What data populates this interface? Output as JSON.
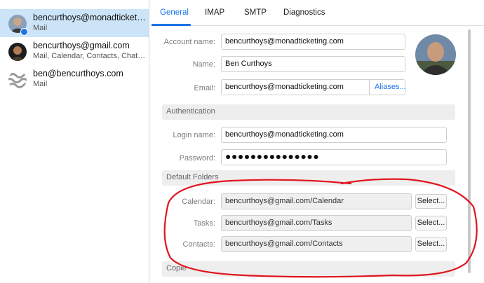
{
  "accounts": [
    {
      "name": "bencurthoys@monadticketing...",
      "sub": "Mail",
      "avatar": "person-photo-avatar",
      "selected": true
    },
    {
      "name": "bencurthoys@gmail.com",
      "sub": "Mail, Calendar, Contacts, Chat, Onli...",
      "avatar": "person-photo-avatar",
      "selected": false
    },
    {
      "name": "ben@bencurthoys.com",
      "sub": "Mail",
      "avatar": "wave-logo-avatar",
      "selected": false
    }
  ],
  "tabs": [
    {
      "label": "General",
      "active": true
    },
    {
      "label": "IMAP",
      "active": false
    },
    {
      "label": "SMTP",
      "active": false
    },
    {
      "label": "Diagnostics",
      "active": false
    }
  ],
  "general": {
    "account_name_label": "Account name:",
    "account_name_value": "bencurthoys@monadticketing.com",
    "name_label": "Name:",
    "name_value": "Ben Curthoys",
    "email_label": "Email:",
    "email_value": "bencurthoys@monadticketing.com",
    "aliases_label": "Aliases..."
  },
  "authentication": {
    "section_title": "Authentication",
    "login_label": "Login name:",
    "login_value": "bencurthoys@monadticketing.com",
    "password_label": "Password:",
    "password_value": "●●●●●●●●●●●●●●●"
  },
  "default_folders": {
    "section_title": "Default Folders",
    "calendar_label": "Calendar:",
    "calendar_value": "bencurthoys@gmail.com/Calendar",
    "tasks_label": "Tasks:",
    "tasks_value": "bencurthoys@gmail.com/Tasks",
    "contacts_label": "Contacts:",
    "contacts_value": "bencurthoys@gmail.com/Contacts",
    "select_label": "Select..."
  },
  "copies": {
    "section_title": "Copie"
  },
  "colors": {
    "accent": "#1a73e8",
    "selection": "#cce4f7",
    "annotation": "#e0141e"
  }
}
